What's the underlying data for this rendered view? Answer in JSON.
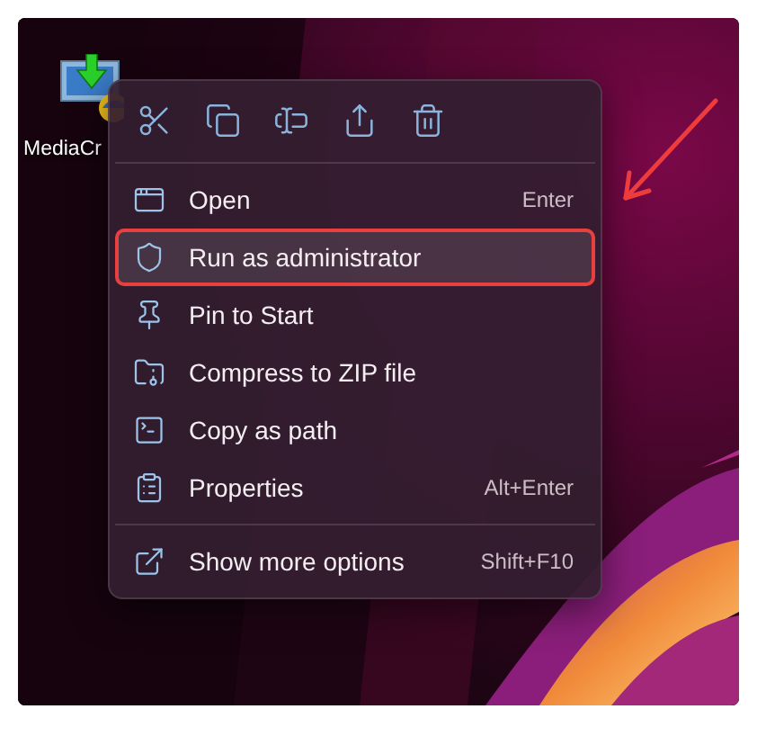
{
  "desktop_icon": {
    "label": "MediaCr"
  },
  "context_menu": {
    "toolbar": [
      {
        "kind": "cut"
      },
      {
        "kind": "copy"
      },
      {
        "kind": "rename"
      },
      {
        "kind": "share"
      },
      {
        "kind": "delete"
      }
    ],
    "items": [
      {
        "kind": "open",
        "label": "Open",
        "shortcut": "Enter",
        "selected": false,
        "outlined": false
      },
      {
        "kind": "admin",
        "label": "Run as administrator",
        "selected": true,
        "outlined": true
      },
      {
        "kind": "pin",
        "label": "Pin to Start",
        "selected": false,
        "outlined": false
      },
      {
        "kind": "zip",
        "label": "Compress to ZIP file",
        "selected": false,
        "outlined": false
      },
      {
        "kind": "path",
        "label": "Copy as path",
        "selected": false,
        "outlined": false
      },
      {
        "kind": "properties",
        "label": "Properties",
        "shortcut": "Alt+Enter",
        "selected": false,
        "outlined": false
      }
    ],
    "footer": {
      "kind": "more",
      "label": "Show more options",
      "shortcut": "Shift+F10"
    }
  }
}
